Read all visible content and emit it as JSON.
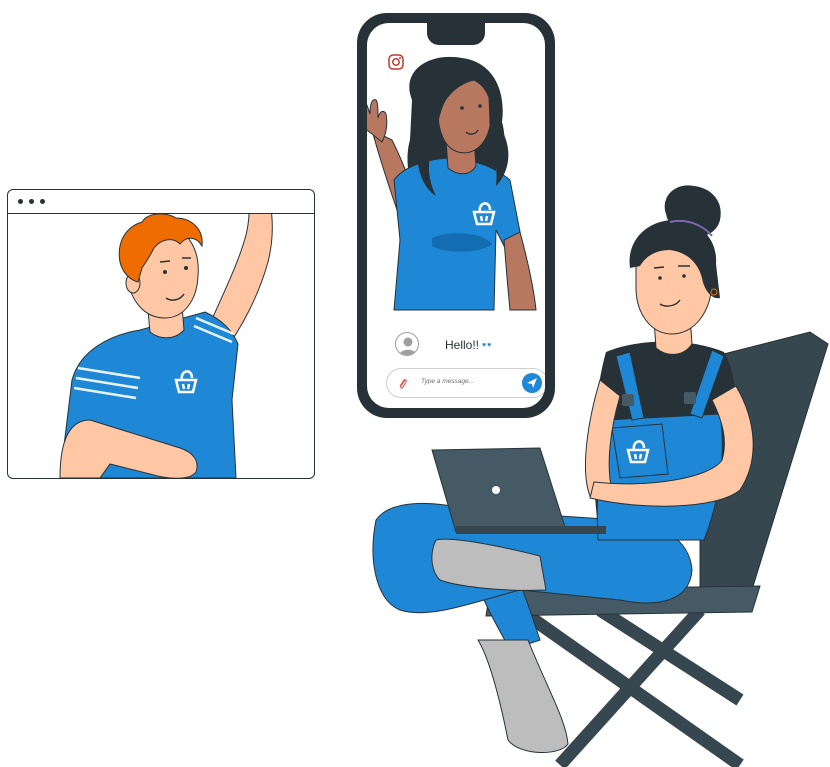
{
  "chat": {
    "message": "Hello!!",
    "reaction": "♥♥",
    "input_placeholder": "Type a message..."
  },
  "icons": {
    "window_controls": "three-dots",
    "social": "instagram-icon",
    "attach": "paperclip-icon",
    "send": "paper-plane-icon",
    "brand": "shopping-basket-logo"
  },
  "colors": {
    "accent_blue": "#1f88d6",
    "dark": "#263238",
    "skin_light": "#ffc7a3",
    "skin_dark": "#b8785f",
    "hair_orange": "#ef6c00"
  }
}
